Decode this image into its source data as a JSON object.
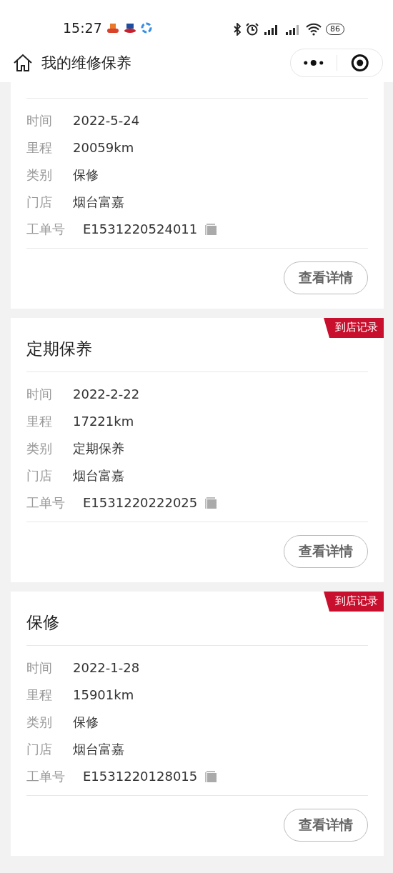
{
  "status_bar": {
    "time": "15:27",
    "battery": "86"
  },
  "nav": {
    "title": "我的维修保养"
  },
  "records": [
    {
      "fields": [
        {
          "kind": "text",
          "label": "时间",
          "value": "2022-5-24"
        },
        {
          "kind": "text",
          "label": "里程",
          "value": "20059km"
        },
        {
          "kind": "text",
          "label": "类别",
          "value": "保修"
        },
        {
          "kind": "text",
          "label": "门店",
          "value": "烟台富嘉"
        },
        {
          "kind": "order",
          "label": "工单号",
          "value": "E1531220524011"
        }
      ],
      "button": "查看详情"
    },
    {
      "title": "定期保养",
      "badge": "到店记录",
      "fields": [
        {
          "kind": "text",
          "label": "时间",
          "value": "2022-2-22"
        },
        {
          "kind": "text",
          "label": "里程",
          "value": "17221km"
        },
        {
          "kind": "text",
          "label": "类别",
          "value": "定期保养"
        },
        {
          "kind": "text",
          "label": "门店",
          "value": "烟台富嘉"
        },
        {
          "kind": "order",
          "label": "工单号",
          "value": "E1531220222025"
        }
      ],
      "button": "查看详情"
    },
    {
      "title": "保修",
      "badge": "到店记录",
      "fields": [
        {
          "kind": "text",
          "label": "时间",
          "value": "2022-1-28"
        },
        {
          "kind": "text",
          "label": "里程",
          "value": "15901km"
        },
        {
          "kind": "text",
          "label": "类别",
          "value": "保修"
        },
        {
          "kind": "text",
          "label": "门店",
          "value": "烟台富嘉"
        },
        {
          "kind": "order",
          "label": "工单号",
          "value": "E1531220128015"
        }
      ],
      "button": "查看详情"
    }
  ]
}
